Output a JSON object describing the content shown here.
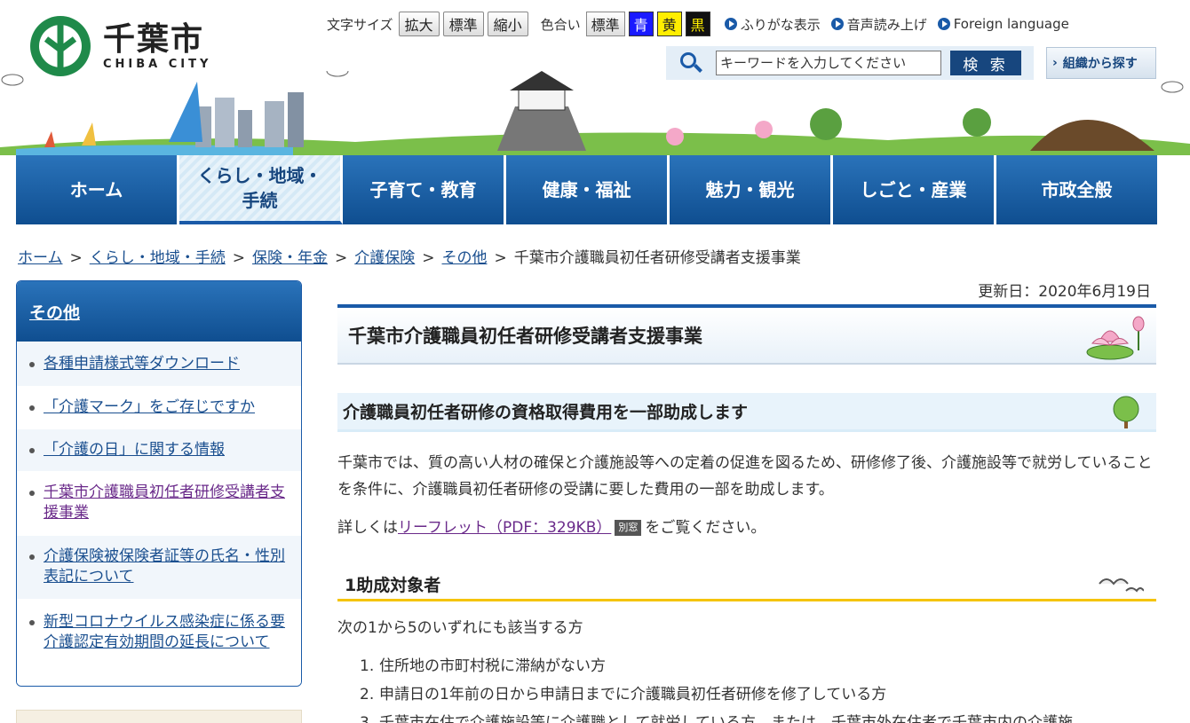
{
  "header": {
    "logo_jp": "千葉市",
    "logo_en": "CHIBA CITY",
    "text_size_label": "文字サイズ",
    "text_size_buttons": [
      "拡大",
      "標準",
      "縮小"
    ],
    "color_label": "色合い",
    "color_buttons": [
      "標準",
      "青",
      "黄",
      "黒"
    ],
    "links": [
      "ふりがな表示",
      "音声読み上げ",
      "Foreign language"
    ],
    "search": {
      "placeholder": "キーワードを入力してください",
      "value": "",
      "button": "検 索"
    },
    "org_search": "組織から探す"
  },
  "nav": {
    "items": [
      "ホーム",
      "くらし・地域・\n手続",
      "子育て・教育",
      "健康・福祉",
      "魅力・観光",
      "しごと・産業",
      "市政全般"
    ],
    "active_index": 1
  },
  "breadcrumb": [
    "ホーム",
    "くらし・地域・手続",
    "保険・年金",
    "介護保険",
    "その他",
    "千葉市介護職員初任者研修受講者支援事業"
  ],
  "breadcrumb_sep": ">",
  "sidebar": {
    "title": "その他",
    "items": [
      "各種申請様式等ダウンロード",
      "「介護マーク」をご存じですか",
      "「介護の日」に関する情報",
      "千葉市介護職員初任者研修受講者支援事業",
      "介護保険被保険者証等の氏名・性別表記について",
      "新型コロナウイルス感染症に係る要介護認定有効期間の延長について"
    ],
    "current_index": 3
  },
  "main": {
    "updated": "更新日：2020年6月19日",
    "title": "千葉市介護職員初任者研修受講者支援事業",
    "h2": "介護職員初任者研修の資格取得費用を一部助成します",
    "para1": "千葉市では、質の高い人材の確保と介護施設等への定着の促進を図るため、研修修了後、介護施設等で就労していることを条件に、介護職員初任者研修の受講に要した費用の一部を助成します。",
    "para2_prefix": "詳しくは",
    "para2_link": "リーフレット（PDF：329KB）",
    "para2_badge": "別窓",
    "para2_suffix": "をご覧ください。",
    "h3": "1助成対象者",
    "para3": "次の1から5のいずれにも該当する方",
    "conditions": [
      "住所地の市町村税に滞納がない方",
      "申請日の1年前の日から申請日までに介護職員初任者研修を修了している方",
      "千葉市在住で介護施設等に介護職として就労している方、または、千葉市外在住者で千葉市内の介護施"
    ]
  },
  "colors": {
    "nav_blue": "#0f4e90",
    "accent_yellow": "#f5c400",
    "link_blue": "#1a4f8f",
    "visited_purple": "#6a2a8a"
  }
}
